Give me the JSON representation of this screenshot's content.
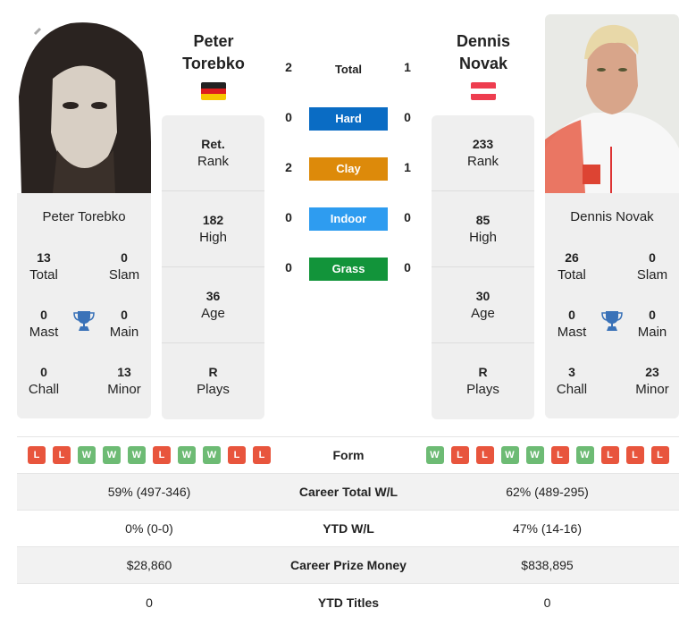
{
  "player1": {
    "name": "Peter Torebko",
    "first_name": "Peter",
    "last_name": "Torebko",
    "flag": "germany-flag",
    "rank_value": "Ret.",
    "rank_label": "Rank",
    "high_value": "182",
    "high_label": "High",
    "age_value": "36",
    "age_label": "Age",
    "plays_value": "R",
    "plays_label": "Plays",
    "titles": {
      "total": {
        "value": "13",
        "label": "Total"
      },
      "slam": {
        "value": "0",
        "label": "Slam"
      },
      "mast": {
        "value": "0",
        "label": "Mast"
      },
      "main": {
        "value": "0",
        "label": "Main"
      },
      "chall": {
        "value": "0",
        "label": "Chall"
      },
      "minor": {
        "value": "13",
        "label": "Minor"
      }
    },
    "form": [
      "L",
      "L",
      "W",
      "W",
      "W",
      "L",
      "W",
      "W",
      "L",
      "L"
    ],
    "career_wl": "59% (497-346)",
    "ytd_wl": "0% (0-0)",
    "prize_money": "$28,860",
    "ytd_titles": "0"
  },
  "player2": {
    "name": "Dennis Novak",
    "first_name": "Dennis",
    "last_name": "Novak",
    "flag": "austria-flag",
    "rank_value": "233",
    "rank_label": "Rank",
    "high_value": "85",
    "high_label": "High",
    "age_value": "30",
    "age_label": "Age",
    "plays_value": "R",
    "plays_label": "Plays",
    "titles": {
      "total": {
        "value": "26",
        "label": "Total"
      },
      "slam": {
        "value": "0",
        "label": "Slam"
      },
      "mast": {
        "value": "0",
        "label": "Mast"
      },
      "main": {
        "value": "0",
        "label": "Main"
      },
      "chall": {
        "value": "3",
        "label": "Chall"
      },
      "minor": {
        "value": "23",
        "label": "Minor"
      }
    },
    "form": [
      "W",
      "L",
      "L",
      "W",
      "W",
      "L",
      "W",
      "L",
      "L",
      "L"
    ],
    "career_wl": "62% (489-295)",
    "ytd_wl": "47% (14-16)",
    "prize_money": "$838,895",
    "ytd_titles": "0"
  },
  "h2h": {
    "total": {
      "label": "Total",
      "p1": "2",
      "p2": "1"
    },
    "surfaces": [
      {
        "label": "Hard",
        "p1": "0",
        "p2": "0",
        "color": "#0a6cc4"
      },
      {
        "label": "Clay",
        "p1": "2",
        "p2": "1",
        "color": "#dd8a0a"
      },
      {
        "label": "Indoor",
        "p1": "0",
        "p2": "0",
        "color": "#2e9cf0"
      },
      {
        "label": "Grass",
        "p1": "0",
        "p2": "0",
        "color": "#12943a"
      }
    ]
  },
  "table": {
    "form_label": "Form",
    "career_wl_label": "Career Total W/L",
    "ytd_wl_label": "YTD W/L",
    "prize_label": "Career Prize Money",
    "ytd_titles_label": "YTD Titles"
  },
  "colors": {
    "win": "#6dbb74",
    "loss": "#e8553d",
    "trophy": "#3a72b8",
    "card_bg": "#efefef"
  }
}
